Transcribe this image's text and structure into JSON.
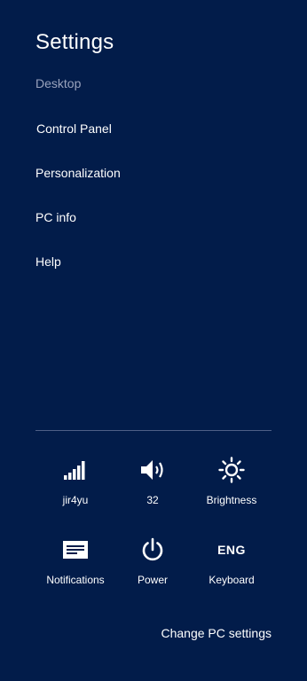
{
  "panel": {
    "title": "Settings",
    "subtitle": "Desktop"
  },
  "links": [
    {
      "label": "Control Panel"
    },
    {
      "label": "Personalization"
    },
    {
      "label": "PC info"
    },
    {
      "label": "Help"
    }
  ],
  "quick_settings": {
    "network": {
      "label": "jir4yu",
      "icon": "wifi-signal-icon"
    },
    "volume": {
      "label": "32",
      "icon": "speaker-icon"
    },
    "brightness": {
      "label": "Brightness",
      "icon": "brightness-icon"
    },
    "notifications": {
      "label": "Notifications",
      "icon": "notifications-icon"
    },
    "power": {
      "label": "Power",
      "icon": "power-icon"
    },
    "keyboard": {
      "label": "Keyboard",
      "icon_text": "ENG"
    }
  },
  "footer": {
    "change_settings": "Change PC settings"
  },
  "colors": {
    "background": "#021c4a",
    "muted_text": "#9aa3bd",
    "divider": "#4e5f86"
  }
}
